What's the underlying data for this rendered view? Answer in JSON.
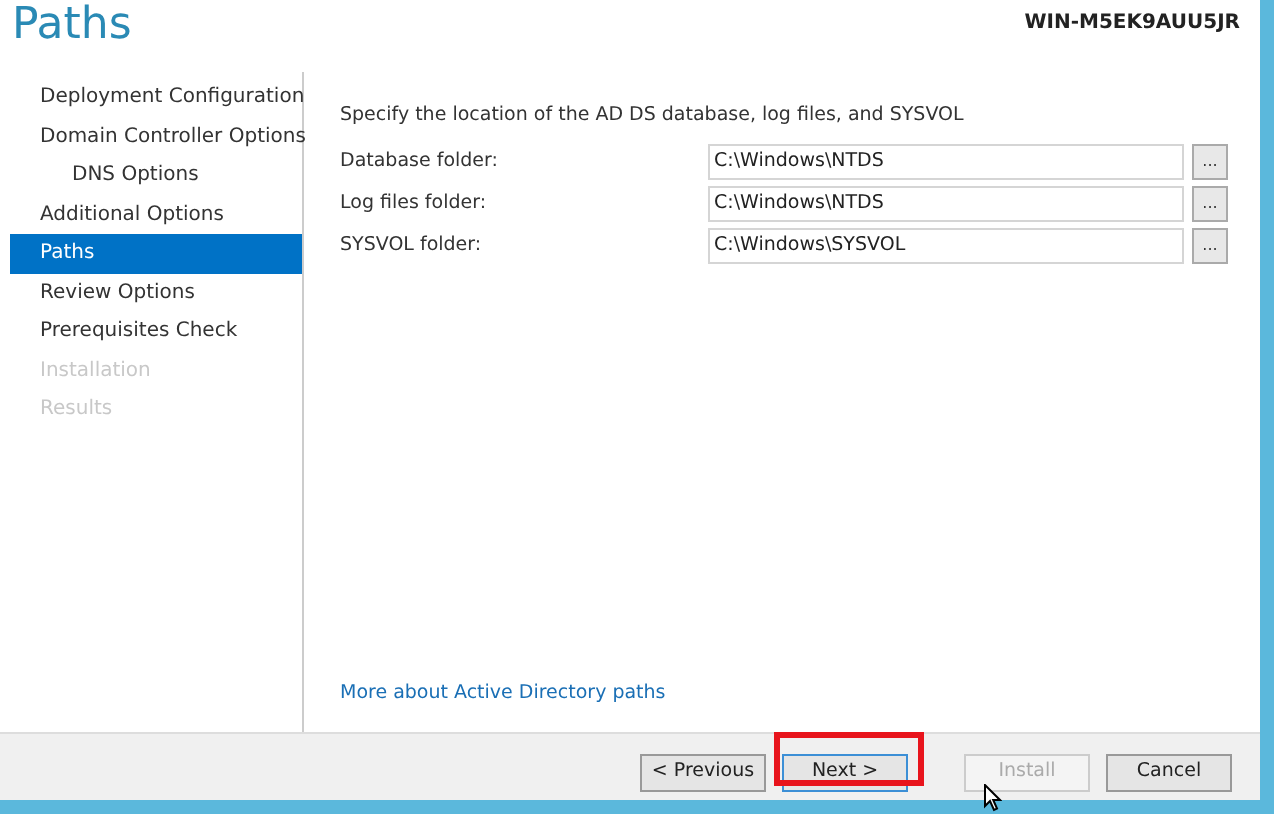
{
  "title": "Paths",
  "target_server": {
    "name": "WIN-M5EK9AUU5JR"
  },
  "sidebar": {
    "items": [
      {
        "label": "Deployment Configuration",
        "selected": false,
        "disabled": false
      },
      {
        "label": "Domain Controller Options",
        "selected": false,
        "disabled": false,
        "children": [
          {
            "label": "DNS Options",
            "selected": false,
            "disabled": false
          }
        ]
      },
      {
        "label": "Additional Options",
        "selected": false,
        "disabled": false
      },
      {
        "label": "Paths",
        "selected": true,
        "disabled": false
      },
      {
        "label": "Review Options",
        "selected": false,
        "disabled": false
      },
      {
        "label": "Prerequisites Check",
        "selected": false,
        "disabled": false
      },
      {
        "label": "Installation",
        "selected": false,
        "disabled": true
      },
      {
        "label": "Results",
        "selected": false,
        "disabled": true
      }
    ]
  },
  "content": {
    "intro": "Specify the location of the AD DS database, log files, and SYSVOL",
    "fields": [
      {
        "label": "Database folder:",
        "value": "C:\\Windows\\NTDS",
        "browse": "..."
      },
      {
        "label": "Log files folder:",
        "value": "C:\\Windows\\NTDS",
        "browse": "..."
      },
      {
        "label": "SYSVOL folder:",
        "value": "C:\\Windows\\SYSVOL",
        "browse": "..."
      }
    ],
    "link": "More about Active Directory paths"
  },
  "buttons": [
    {
      "label": "< Previous",
      "disabled": false,
      "focused": false,
      "highlighted": false
    },
    {
      "label": "Next >",
      "disabled": false,
      "focused": true,
      "highlighted": true
    },
    {
      "label": "Install",
      "disabled": true,
      "focused": false,
      "highlighted": false
    },
    {
      "label": "Cancel",
      "disabled": false,
      "focused": false,
      "highlighted": false
    }
  ]
}
